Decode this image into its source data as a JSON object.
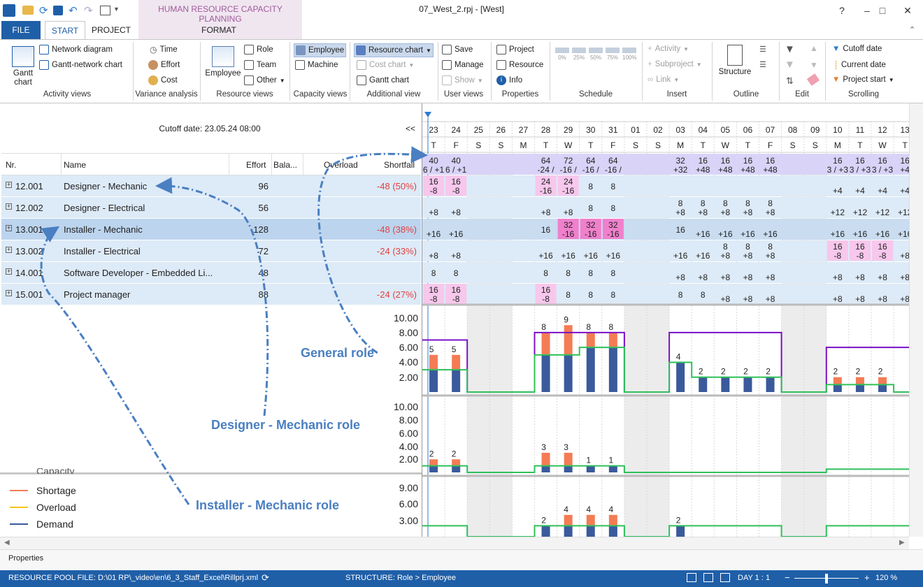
{
  "window": {
    "doc_title": "07_West_2.rpj - [West]",
    "context_tab_group": "HUMAN RESOURCE CAPACITY PLANNING"
  },
  "tabs": [
    "FILE",
    "START",
    "PROJECT",
    "FORMAT"
  ],
  "ribbon": {
    "activity_views": {
      "label": "Activity views",
      "gantt": "Gantt chart",
      "network": "Network diagram",
      "gantt_network": "Gantt-network chart"
    },
    "variance": {
      "label": "Variance analysis",
      "time": "Time",
      "effort": "Effort",
      "cost": "Cost"
    },
    "resource_views": {
      "label": "Resource views",
      "employee": "Employee",
      "role": "Role",
      "team": "Team",
      "other": "Other"
    },
    "capacity_views": {
      "label": "Capacity views",
      "employee": "Employee",
      "machine": "Machine"
    },
    "additional_view": {
      "label": "Additional view",
      "resource_chart": "Resource chart",
      "cost_chart": "Cost chart",
      "gantt_chart": "Gantt chart"
    },
    "user_views": {
      "label": "User views",
      "save": "Save",
      "manage": "Manage",
      "show": "Show"
    },
    "properties": {
      "label": "Properties",
      "project": "Project",
      "resource": "Resource",
      "info": "Info"
    },
    "schedule": {
      "label": "Schedule",
      "pcts": [
        "0%",
        "25%",
        "50%",
        "75%",
        "100%"
      ]
    },
    "insert": {
      "label": "Insert",
      "activity": "Activity",
      "subproject": "Subproject",
      "link": "Link"
    },
    "outline": {
      "label": "Outline",
      "structure": "Structure"
    },
    "edit": {
      "label": "Edit"
    },
    "scrolling": {
      "label": "Scrolling",
      "cutoff": "Cutoff date",
      "current": "Current date",
      "project_start": "Project start"
    }
  },
  "grid": {
    "cutoff": "Cutoff date: 23.05.24 08:00",
    "collapse": "<<",
    "headers": {
      "nr": "Nr.",
      "name": "Name",
      "effort": "Effort",
      "balance": "Bala...",
      "overload": "Overload",
      "shortfall": "Shortfall"
    },
    "rows": [
      {
        "nr": "12.001",
        "name": "Designer - Mechanic",
        "effort": "96",
        "shortfall": "-48 (50%)"
      },
      {
        "nr": "12.002",
        "name": "Designer - Electrical",
        "effort": "56",
        "shortfall": ""
      },
      {
        "nr": "13.001",
        "name": "Installer - Mechanic",
        "effort": "128",
        "shortfall": "-48 (38%)"
      },
      {
        "nr": "13.002",
        "name": "Installer - Electrical",
        "effort": "72",
        "shortfall": "-24 (33%)"
      },
      {
        "nr": "14.001",
        "name": "Software Developer - Embedded Li...",
        "effort": "48",
        "shortfall": ""
      },
      {
        "nr": "15.001",
        "name": "Project manager",
        "effort": "88",
        "shortfall": "-24 (27%)"
      }
    ]
  },
  "legend": {
    "capacity": "Capacity",
    "items": [
      {
        "label": "Shortage",
        "color": "#f47c54"
      },
      {
        "label": "Overload",
        "color": "#f5c518"
      },
      {
        "label": "Demand",
        "color": "#3a5a9c"
      }
    ]
  },
  "annotations": {
    "general": "General role",
    "designer": "Designer - Mechanic role",
    "installer": "Installer - Mechanic role"
  },
  "timeline": {
    "days": [
      "23",
      "24",
      "25",
      "26",
      "27",
      "28",
      "29",
      "30",
      "31",
      "01",
      "02",
      "03",
      "04",
      "05",
      "06",
      "07",
      "08",
      "09",
      "10",
      "11",
      "12",
      "13"
    ],
    "weekdays": [
      "T",
      "F",
      "S",
      "S",
      "M",
      "T",
      "W",
      "T",
      "F",
      "S",
      "S",
      "M",
      "T",
      "W",
      "T",
      "F",
      "S",
      "S",
      "M",
      "T",
      "W",
      "T"
    ],
    "weekend_idx": [
      2,
      3,
      9,
      10,
      16,
      17
    ],
    "summary": [
      [
        "40",
        "6 / +1"
      ],
      [
        "40",
        "6 / +1"
      ],
      [
        "",
        ""
      ],
      [
        "",
        ""
      ],
      [
        "",
        ""
      ],
      [
        "64",
        "-24 /"
      ],
      [
        "72",
        "-16 /"
      ],
      [
        "64",
        "-16 /"
      ],
      [
        "64",
        "-16 /"
      ],
      [
        "",
        ""
      ],
      [
        "",
        ""
      ],
      [
        "32",
        "+32"
      ],
      [
        "16",
        "+48"
      ],
      [
        "16",
        "+48"
      ],
      [
        "16",
        "+48"
      ],
      [
        "16",
        "+48"
      ],
      [
        "",
        ""
      ],
      [
        "",
        ""
      ],
      [
        "16",
        "3 / +3"
      ],
      [
        "16",
        "3 / +3"
      ],
      [
        "16",
        "3 / +3"
      ],
      [
        "16",
        "+4"
      ]
    ],
    "cells": [
      [
        [
          "16",
          "-8",
          "p"
        ],
        [
          "16",
          "-8",
          "p"
        ],
        [
          "",
          "",
          ""
        ],
        [
          "",
          "",
          ""
        ],
        [
          "",
          "",
          ""
        ],
        [
          "24",
          "-16",
          "p"
        ],
        [
          "24",
          "-16",
          "p"
        ],
        [
          "8",
          "",
          ""
        ],
        [
          "8",
          "",
          ""
        ],
        [
          "",
          "",
          ""
        ],
        [
          "",
          "",
          ""
        ],
        [
          "",
          "",
          ""
        ],
        [
          "",
          "",
          ""
        ],
        [
          "",
          "",
          ""
        ],
        [
          "",
          "",
          ""
        ],
        [
          "",
          "",
          ""
        ],
        [
          "",
          "",
          ""
        ],
        [
          "",
          "",
          ""
        ],
        [
          "",
          "+4",
          ""
        ],
        [
          "",
          "+4",
          ""
        ],
        [
          "",
          "+4",
          ""
        ],
        [
          "",
          "+4",
          ""
        ]
      ],
      [
        [
          "",
          "+8",
          ""
        ],
        [
          "",
          "+8",
          ""
        ],
        [
          "",
          "",
          ""
        ],
        [
          "",
          "",
          ""
        ],
        [
          "",
          "",
          ""
        ],
        [
          "",
          "+8",
          ""
        ],
        [
          "",
          "+8",
          ""
        ],
        [
          "8",
          "",
          ""
        ],
        [
          "8",
          "",
          ""
        ],
        [
          "",
          "",
          ""
        ],
        [
          "",
          "",
          ""
        ],
        [
          "8",
          "+8",
          ""
        ],
        [
          "8",
          "+8",
          ""
        ],
        [
          "8",
          "+8",
          ""
        ],
        [
          "8",
          "+8",
          ""
        ],
        [
          "8",
          "+8",
          ""
        ],
        [
          "",
          "",
          ""
        ],
        [
          "",
          "",
          ""
        ],
        [
          "",
          "+12",
          ""
        ],
        [
          "",
          "+12",
          ""
        ],
        [
          "",
          "+12",
          ""
        ],
        [
          "",
          "+12",
          ""
        ]
      ],
      [
        [
          "",
          "+16",
          ""
        ],
        [
          "",
          "+16",
          ""
        ],
        [
          "",
          "",
          ""
        ],
        [
          "",
          "",
          ""
        ],
        [
          "",
          "",
          ""
        ],
        [
          "16",
          "",
          ""
        ],
        [
          "32",
          "-16",
          "m"
        ],
        [
          "32",
          "-16",
          "m"
        ],
        [
          "32",
          "-16",
          "m"
        ],
        [
          "",
          "",
          ""
        ],
        [
          "",
          "",
          ""
        ],
        [
          "16",
          "",
          ""
        ],
        [
          "",
          "+16",
          ""
        ],
        [
          "",
          "+16",
          ""
        ],
        [
          "",
          "+16",
          ""
        ],
        [
          "",
          "+16",
          ""
        ],
        [
          "",
          "",
          ""
        ],
        [
          "",
          "",
          ""
        ],
        [
          "",
          "+16",
          ""
        ],
        [
          "",
          "+16",
          ""
        ],
        [
          "",
          "+16",
          ""
        ],
        [
          "",
          "+16",
          ""
        ]
      ],
      [
        [
          "",
          "+8",
          ""
        ],
        [
          "",
          "+8",
          ""
        ],
        [
          "",
          "",
          ""
        ],
        [
          "",
          "",
          ""
        ],
        [
          "",
          "",
          ""
        ],
        [
          "",
          "+16",
          ""
        ],
        [
          "",
          "+16",
          ""
        ],
        [
          "",
          "+16",
          ""
        ],
        [
          "",
          "+16",
          ""
        ],
        [
          "",
          "",
          ""
        ],
        [
          "",
          "",
          ""
        ],
        [
          "",
          "+16",
          ""
        ],
        [
          "",
          "+16",
          ""
        ],
        [
          "8",
          "+8",
          ""
        ],
        [
          "8",
          "+8",
          ""
        ],
        [
          "8",
          "+8",
          ""
        ],
        [
          "",
          "",
          ""
        ],
        [
          "",
          "",
          ""
        ],
        [
          "16",
          "-8",
          "p"
        ],
        [
          "16",
          "-8",
          "p"
        ],
        [
          "16",
          "-8",
          "p"
        ],
        [
          "",
          "+8",
          ""
        ]
      ],
      [
        [
          "8",
          "",
          ""
        ],
        [
          "8",
          "",
          ""
        ],
        [
          "",
          "",
          ""
        ],
        [
          "",
          "",
          ""
        ],
        [
          "",
          "",
          ""
        ],
        [
          "8",
          "",
          ""
        ],
        [
          "8",
          "",
          ""
        ],
        [
          "8",
          "",
          ""
        ],
        [
          "8",
          "",
          ""
        ],
        [
          "",
          "",
          ""
        ],
        [
          "",
          "",
          ""
        ],
        [
          "",
          "+8",
          ""
        ],
        [
          "",
          "+8",
          ""
        ],
        [
          "",
          "+8",
          ""
        ],
        [
          "",
          "+8",
          ""
        ],
        [
          "",
          "+8",
          ""
        ],
        [
          "",
          "",
          ""
        ],
        [
          "",
          "",
          ""
        ],
        [
          "",
          "+8",
          ""
        ],
        [
          "",
          "+8",
          ""
        ],
        [
          "",
          "+8",
          ""
        ],
        [
          "",
          "+8",
          ""
        ]
      ],
      [
        [
          "16",
          "-8",
          "p"
        ],
        [
          "16",
          "-8",
          "p"
        ],
        [
          "",
          "",
          ""
        ],
        [
          "",
          "",
          ""
        ],
        [
          "",
          "",
          ""
        ],
        [
          "16",
          "-8",
          "p"
        ],
        [
          "8",
          "",
          ""
        ],
        [
          "8",
          "",
          ""
        ],
        [
          "8",
          "",
          ""
        ],
        [
          "",
          "",
          ""
        ],
        [
          "",
          "",
          ""
        ],
        [
          "8",
          "",
          ""
        ],
        [
          "8",
          "",
          ""
        ],
        [
          "",
          "+8",
          ""
        ],
        [
          "",
          "+8",
          ""
        ],
        [
          "",
          "+8",
          ""
        ],
        [
          "",
          "",
          ""
        ],
        [
          "",
          "",
          ""
        ],
        [
          "",
          "+8",
          ""
        ],
        [
          "",
          "+8",
          ""
        ],
        [
          "",
          "+8",
          ""
        ],
        [
          "",
          "+8",
          ""
        ]
      ]
    ]
  },
  "chart_data": [
    {
      "type": "bar",
      "name": "General role",
      "ylim": [
        0,
        11
      ],
      "yticks": [
        "10.00",
        "8.00",
        "6.00",
        "4.00",
        "2.00"
      ],
      "ytick_values": [
        10,
        8,
        6,
        4,
        2
      ],
      "demand": [
        3,
        3,
        0,
        0,
        0,
        5,
        5,
        6,
        6,
        0,
        0,
        4,
        2,
        2,
        2,
        2,
        0,
        0,
        1,
        1,
        1,
        0
      ],
      "shortage": [
        2,
        2,
        0,
        0,
        0,
        3,
        4,
        2,
        2,
        0,
        0,
        0,
        0,
        0,
        0,
        0,
        0,
        0,
        1,
        1,
        1,
        0
      ],
      "labels": [
        "5",
        "5",
        "",
        "",
        "",
        "8",
        "9",
        "8",
        "8",
        "",
        "",
        "4",
        "2",
        "2",
        "2",
        "2",
        "",
        "",
        "2",
        "2",
        "2",
        ""
      ],
      "capacity": [
        7,
        7,
        0,
        0,
        0,
        8,
        8,
        8,
        8,
        0,
        0,
        8,
        8,
        8,
        8,
        8,
        0,
        0,
        6,
        6,
        6,
        6
      ],
      "capacity_green": [
        3,
        3,
        0,
        0,
        0,
        5,
        5,
        6,
        6,
        0,
        0,
        4,
        2,
        2,
        2,
        2,
        0,
        0,
        1,
        1,
        1,
        0
      ]
    },
    {
      "type": "bar",
      "name": "Designer - Mechanic role",
      "ylim": [
        0,
        11
      ],
      "yticks": [
        "10.00",
        "8.00",
        "6.00",
        "4.00",
        "2.00"
      ],
      "ytick_values": [
        10,
        8,
        6,
        4,
        2
      ],
      "demand": [
        1,
        1,
        0,
        0,
        0,
        1,
        1,
        1,
        1,
        0,
        0,
        0,
        0,
        0,
        0,
        0,
        0,
        0,
        0,
        0,
        0,
        0
      ],
      "shortage": [
        1,
        1,
        0,
        0,
        0,
        2,
        2,
        0,
        0,
        0,
        0,
        0,
        0,
        0,
        0,
        0,
        0,
        0,
        0,
        0,
        0,
        0
      ],
      "labels": [
        "2",
        "2",
        "",
        "",
        "",
        "3",
        "3",
        "1",
        "1",
        "",
        "",
        "",
        "",
        "",
        "",
        "",
        "",
        "",
        "",
        "",
        "",
        ""
      ],
      "capacity_green": [
        1,
        1,
        0,
        0,
        0,
        1,
        1,
        1,
        1,
        0,
        0,
        0,
        0,
        0,
        0,
        0,
        0,
        0,
        0.5,
        0.5,
        0.5,
        0.5
      ]
    },
    {
      "type": "bar",
      "name": "Installer - Mechanic role",
      "ylim": [
        0,
        10
      ],
      "yticks": [
        "9.00",
        "6.00",
        "3.00"
      ],
      "ytick_values": [
        9,
        6,
        3
      ],
      "demand": [
        0,
        0,
        0,
        0,
        0,
        2,
        2,
        2,
        2,
        0,
        0,
        2,
        0,
        0,
        0,
        0,
        0,
        0,
        0,
        0,
        0,
        0
      ],
      "shortage": [
        0,
        0,
        0,
        0,
        0,
        0,
        2,
        2,
        2,
        0,
        0,
        0,
        0,
        0,
        0,
        0,
        0,
        0,
        0,
        0,
        0,
        0
      ],
      "labels": [
        "",
        "",
        "",
        "",
        "",
        "2",
        "4",
        "4",
        "4",
        "",
        "",
        "2",
        "",
        "",
        "",
        "",
        "",
        "",
        "",
        "",
        "",
        ""
      ],
      "capacity_green": [
        2,
        2,
        0,
        0,
        0,
        2,
        2,
        2,
        2,
        0,
        0,
        2,
        2,
        2,
        2,
        2,
        0,
        0,
        2,
        2,
        2,
        2
      ]
    }
  ],
  "status": {
    "pool": "RESOURCE POOL FILE: D:\\01 RP\\_video\\en\\6_3_Staff_Excel\\Rillprj.xml",
    "structure": "STRUCTURE: Role > Employee",
    "day": "DAY 1 : 1",
    "zoom": "120 %"
  },
  "props_label": "Properties",
  "colors": {
    "accent": "#1f5fa8",
    "capacity": "#7b10c8",
    "green": "#2ec05a",
    "pink": "#f7c7ec",
    "magenta": "#f080cc",
    "summary": "#d9d3f8"
  }
}
